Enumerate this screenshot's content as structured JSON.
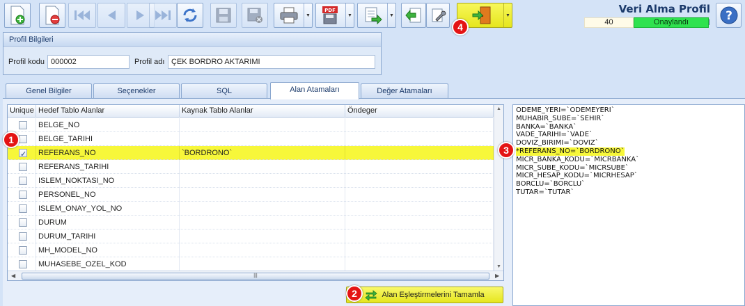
{
  "window": {
    "title": "Veri Alma Profil Tanımı",
    "record_count": "40",
    "status": "Onaylandı",
    "status_color": "#2fe24f"
  },
  "toolbar": {
    "buttons": [
      {
        "name": "new-record",
        "icon": "add-document-icon"
      },
      {
        "name": "delete-record",
        "icon": "delete-document-icon"
      },
      {
        "name": "first-record",
        "icon": "first-record-icon"
      },
      {
        "name": "previous-record",
        "icon": "previous-record-icon"
      },
      {
        "name": "next-record",
        "icon": "next-record-icon"
      },
      {
        "name": "last-record",
        "icon": "last-record-icon"
      },
      {
        "name": "refresh",
        "icon": "refresh-icon"
      },
      {
        "name": "save",
        "icon": "save-icon"
      },
      {
        "name": "save-cancel",
        "icon": "save-cancel-icon"
      },
      {
        "name": "print",
        "icon": "printer-icon"
      },
      {
        "name": "pdf-export",
        "icon": "pdf-icon",
        "label": "PDF"
      },
      {
        "name": "export",
        "icon": "export-icon"
      },
      {
        "name": "import",
        "icon": "import-icon"
      },
      {
        "name": "tools",
        "icon": "wrench-icon"
      },
      {
        "name": "exit",
        "icon": "exit-door-icon"
      }
    ],
    "help_icon": "help-icon",
    "help_label": "?"
  },
  "profile": {
    "group_title": "Profil Bilgileri",
    "code_label": "Profil kodu",
    "code_value": "000002",
    "name_label": "Profil adı",
    "name_value": "ÇEK BORDRO AKTARIMI"
  },
  "tabs": [
    {
      "label": "Genel Bilgiler",
      "active": false
    },
    {
      "label": "Seçenekler",
      "active": false
    },
    {
      "label": "SQL",
      "active": false
    },
    {
      "label": "Alan Atamaları",
      "active": true
    },
    {
      "label": "Değer Atamaları",
      "active": false
    }
  ],
  "grid": {
    "columns": [
      "Unique",
      "Hedef Tablo Alanlar",
      "Kaynak Tablo Alanlar",
      "Öndeger"
    ],
    "rows": [
      {
        "unique": false,
        "target": "BELGE_NO",
        "source": "",
        "default": "",
        "highlight": false
      },
      {
        "unique": false,
        "target": "BELGE_TARIHI",
        "source": "",
        "default": "",
        "highlight": false
      },
      {
        "unique": true,
        "target": "REFERANS_NO",
        "source": "`BORDRONO`",
        "default": "",
        "highlight": true
      },
      {
        "unique": false,
        "target": "REFERANS_TARIHI",
        "source": "",
        "default": "",
        "highlight": false
      },
      {
        "unique": false,
        "target": "ISLEM_NOKTASI_NO",
        "source": "",
        "default": "",
        "highlight": false
      },
      {
        "unique": false,
        "target": "PERSONEL_NO",
        "source": "",
        "default": "",
        "highlight": false
      },
      {
        "unique": false,
        "target": "ISLEM_ONAY_YOL_NO",
        "source": "",
        "default": "",
        "highlight": false
      },
      {
        "unique": false,
        "target": "DURUM",
        "source": "",
        "default": "",
        "highlight": false
      },
      {
        "unique": false,
        "target": "DURUM_TARIHI",
        "source": "",
        "default": "",
        "highlight": false
      },
      {
        "unique": false,
        "target": "MH_MODEL_NO",
        "source": "",
        "default": "",
        "highlight": false
      },
      {
        "unique": false,
        "target": "MUHASEBE_OZEL_KOD",
        "source": "",
        "default": "",
        "highlight": false
      }
    ],
    "highlight_color": "#f7f73a"
  },
  "mapping_lines": [
    {
      "text": "ODEME_YERI=`ODEMEYERI`",
      "highlight": false
    },
    {
      "text": "MUHABIR_SUBE=`SEHIR`",
      "highlight": false
    },
    {
      "text": "BANKA=`BANKA`",
      "highlight": false
    },
    {
      "text": "VADE_TARIHI=`VADE`",
      "highlight": false
    },
    {
      "text": "DOVIZ_BIRIMI=`DOVIZ`",
      "highlight": false
    },
    {
      "text": "*REFERANS_NO=`BORDRONO`",
      "highlight": true
    },
    {
      "text": "MICR_BANKA_KODU=`MICRBANKA`",
      "highlight": false
    },
    {
      "text": "MICR_SUBE_KODU=`MICRSUBE`",
      "highlight": false
    },
    {
      "text": "MICR_HESAP_KODU=`MICRHESAP`",
      "highlight": false
    },
    {
      "text": "BORCLU=`BORCLU`",
      "highlight": false
    },
    {
      "text": "TUTAR=`TUTAR`",
      "highlight": false
    }
  ],
  "complete_button": {
    "label": "Alan Eşleştirmelerini Tamamla",
    "icon": "swap-arrows-icon"
  },
  "markers": [
    "1",
    "2",
    "3",
    "4"
  ],
  "colors": {
    "accent_yellow": "#f7f73a",
    "marker_red": "#e41414",
    "frame_blue": "#8aa7cf"
  }
}
